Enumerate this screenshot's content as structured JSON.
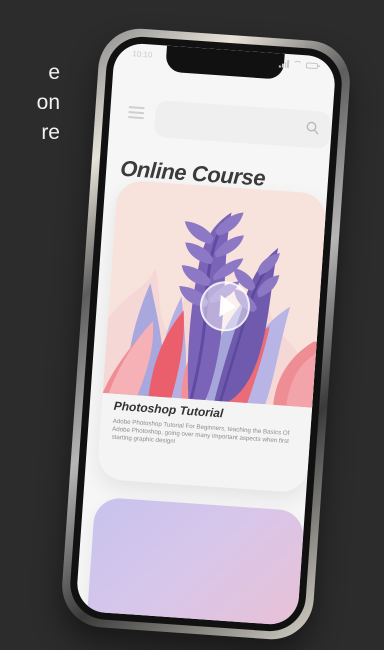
{
  "background": {
    "partial_text_lines": [
      "e",
      "on",
      "re"
    ]
  },
  "status_bar": {
    "time": "10:10"
  },
  "search": {
    "placeholder": ""
  },
  "page": {
    "title": "Online Course"
  },
  "course_card": {
    "title": "Photoshop Tutorial",
    "description": "Adobe Photoshop Tutorial For Beginners, teaching the Basics Of Adobe Photoshop, going over many important aspects when first starting graphic design!"
  },
  "icons": {
    "menu": "menu-icon",
    "search": "search-icon",
    "play": "play-icon",
    "signal": "signal-icon",
    "wifi": "wifi-icon",
    "battery": "battery-icon"
  },
  "colors": {
    "background": "#2c2c2c",
    "screen": "#f6f6f6",
    "card": "#f4f4f4",
    "art_bg": "#f8e3dc",
    "purple": "#7b63b7",
    "lavender": "#a6a8dd",
    "pink": "#ef8d95",
    "coral": "#ea5f6b"
  }
}
